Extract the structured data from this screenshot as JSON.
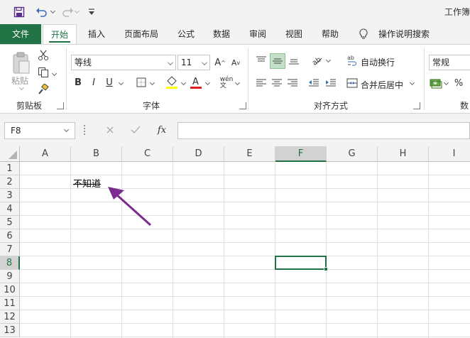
{
  "window": {
    "title": "工作簿"
  },
  "ribbon_tabs": [
    "文件",
    "开始",
    "插入",
    "页面布局",
    "公式",
    "数据",
    "审阅",
    "视图",
    "帮助",
    "操作说明搜索"
  ],
  "clipboard": {
    "paste_label": "粘贴",
    "group_label": "剪贴板"
  },
  "font": {
    "name": "等线",
    "size": "11",
    "group_label": "字体"
  },
  "alignment": {
    "wrap_label": "自动换行",
    "merge_label": "合并后居中",
    "group_label": "对齐方式"
  },
  "number": {
    "format": "常规",
    "group_label": "数"
  },
  "formula_bar": {
    "name_box": "F8",
    "fx": "fx",
    "value": ""
  },
  "grid": {
    "columns": [
      "A",
      "B",
      "C",
      "D",
      "E",
      "F",
      "G",
      "H",
      "I"
    ],
    "rows": [
      "1",
      "2",
      "3",
      "4",
      "5",
      "6",
      "7",
      "8",
      "9",
      "10",
      "11",
      "12",
      "13"
    ],
    "selected_cell": "F8",
    "cells": {
      "B2": "不知道"
    }
  },
  "colors": {
    "accent": "#217346",
    "arrow": "#7b2c8f"
  }
}
